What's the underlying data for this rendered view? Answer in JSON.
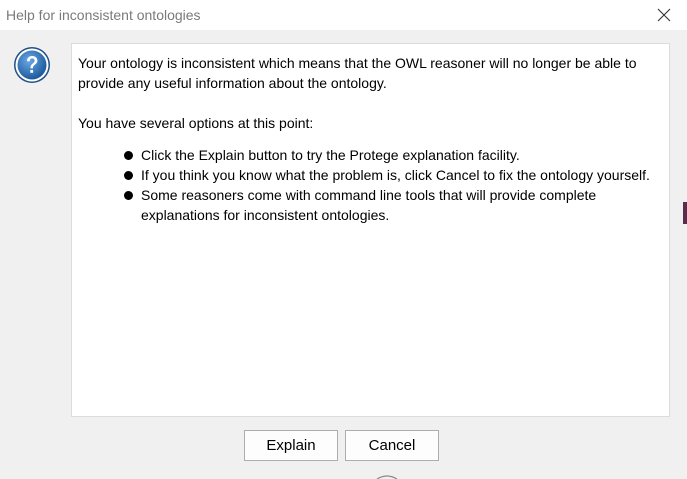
{
  "window": {
    "title": "Help for inconsistent ontologies",
    "close_icon": "close-icon"
  },
  "icons": {
    "question": "question-icon"
  },
  "colors": {
    "icon_blue": "#2a6fb5",
    "icon_inner": "#4a90d6",
    "button_border": "#adadad",
    "background": "#f0f0f0"
  },
  "message": {
    "intro": "Your ontology is inconsistent which means that the OWL reasoner will no longer be able to provide any useful information about the ontology.",
    "options_heading": "You have several options at this point:",
    "options": [
      "Click the Explain button to try the Protege explanation facility.",
      "If you think you know what the problem is, click Cancel to fix the ontology yourself.",
      "Some reasoners come with command line tools that will provide complete explanations for inconsistent ontologies."
    ]
  },
  "buttons": {
    "explain": "Explain",
    "cancel": "Cancel"
  }
}
